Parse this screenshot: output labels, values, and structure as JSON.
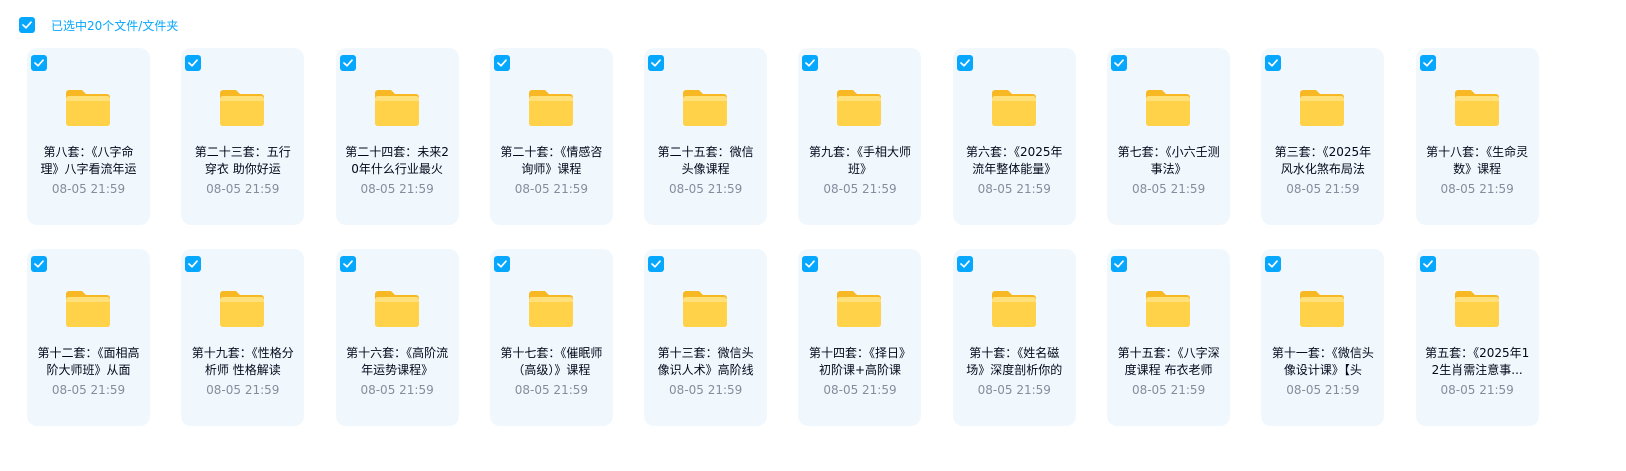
{
  "header": {
    "selected_text": "已选中20个文件/文件夹"
  },
  "colors": {
    "accent": "#06a7ff",
    "card_bg": "#f1f8fd",
    "folder": "#ffcd3c"
  },
  "files": [
    {
      "name": "第八套：《八字命理》八字看流年运",
      "time": "08-05 21:59",
      "icon": "folder-icon",
      "checked": true
    },
    {
      "name": "第二十三套：五行穿衣 助你好运",
      "time": "08-05 21:59",
      "icon": "folder-icon",
      "checked": true
    },
    {
      "name": "第二十四套：未来20年什么行业最火",
      "time": "08-05 21:59",
      "icon": "folder-icon",
      "checked": true
    },
    {
      "name": "第二十套：《情感咨询师》课程",
      "time": "08-05 21:59",
      "icon": "folder-icon",
      "checked": true
    },
    {
      "name": "第二十五套：微信头像课程",
      "time": "08-05 21:59",
      "icon": "folder-icon",
      "checked": true
    },
    {
      "name": "第九套：《手相大师班》",
      "time": "08-05 21:59",
      "icon": "folder-icon",
      "checked": true
    },
    {
      "name": "第六套：《2025年流年整体能量》",
      "time": "08-05 21:59",
      "icon": "folder-icon",
      "checked": true
    },
    {
      "name": "第七套：《小六壬测事法》",
      "time": "08-05 21:59",
      "icon": "folder-icon",
      "checked": true
    },
    {
      "name": "第三套：《2025年风水化煞布局法",
      "time": "08-05 21:59",
      "icon": "folder-icon",
      "checked": true
    },
    {
      "name": "第十八套：《生命灵数》课程",
      "time": "08-05 21:59",
      "icon": "folder-icon",
      "checked": true
    },
    {
      "name": "第十二套：《面相高阶大师班》从面",
      "time": "08-05 21:59",
      "icon": "folder-icon",
      "checked": true
    },
    {
      "name": "第十九套：《性格分析师 性格解读",
      "time": "08-05 21:59",
      "icon": "folder-icon",
      "checked": true
    },
    {
      "name": "第十六套：《高阶流年运势课程》",
      "time": "08-05 21:59",
      "icon": "folder-icon",
      "checked": true
    },
    {
      "name": "第十七套：《催眠师（高级）》课程",
      "time": "08-05 21:59",
      "icon": "folder-icon",
      "checked": true
    },
    {
      "name": "第十三套：微信头像识人术》高阶线",
      "time": "08-05 21:59",
      "icon": "folder-icon",
      "checked": true
    },
    {
      "name": "第十四套：《择日》初阶课+高阶课",
      "time": "08-05 21:59",
      "icon": "folder-icon",
      "checked": true
    },
    {
      "name": "第十套：《姓名磁场》深度剖析你的",
      "time": "08-05 21:59",
      "icon": "folder-icon",
      "checked": true
    },
    {
      "name": "第十五套：《八字深度课程 布衣老师",
      "time": "08-05 21:59",
      "icon": "folder-icon",
      "checked": true
    },
    {
      "name": "第十一套：《微信头像设计课》【头",
      "time": "08-05 21:59",
      "icon": "folder-icon",
      "checked": true
    },
    {
      "name": "第五套：《2025年12生肖需注意事...",
      "time": "08-05 21:59",
      "icon": "folder-icon",
      "checked": true
    }
  ]
}
